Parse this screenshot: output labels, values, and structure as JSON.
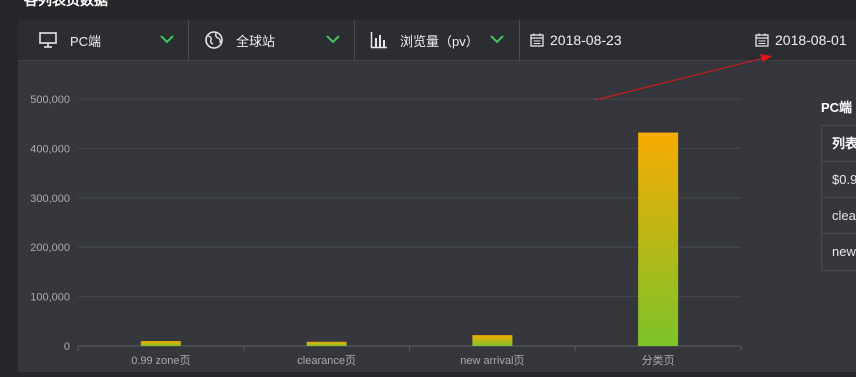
{
  "page_title": "各列表页数据",
  "toolbar": {
    "platform": {
      "label": "PC端",
      "icon": "monitor-icon"
    },
    "region": {
      "label": "全球站",
      "icon": "globe-icon"
    },
    "metric": {
      "label": "浏览量（pv）",
      "icon": "bar-chart-icon"
    },
    "start_date": "2018-08-23",
    "end_date": "2018-08-01"
  },
  "colors": {
    "bar_top": "#f7ab02",
    "bar_bottom": "#7cc32a",
    "chevron": "#3fc45c",
    "arrow": "#e01818"
  },
  "chart_data": {
    "type": "bar",
    "categories": [
      "0.99 zone页",
      "clearance页",
      "new arrival页",
      "分类页"
    ],
    "values": [
      10000,
      8500,
      22000,
      432000
    ],
    "yticks": [
      "0",
      "100,000",
      "200,000",
      "300,000",
      "400,000",
      "500,000"
    ],
    "ylim": [
      0,
      500000
    ],
    "grid": true
  },
  "side_panel": {
    "title": "PC端",
    "rows": [
      "列表",
      "$0.9",
      "clea",
      "new"
    ]
  }
}
